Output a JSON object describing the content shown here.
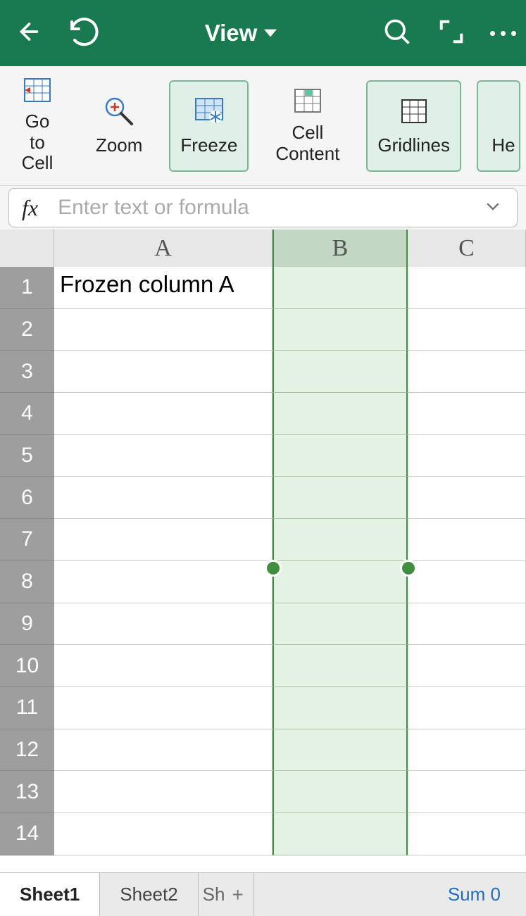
{
  "header": {
    "title": "View"
  },
  "ribbon": {
    "goToCell": "Go to\nCell",
    "zoom": "Zoom",
    "freeze": "Freeze",
    "cellContent": "Cell\nContent",
    "gridlines": "Gridlines",
    "headings": "He"
  },
  "formulaBar": {
    "fx": "fx",
    "placeholder": "Enter text or formula"
  },
  "columns": {
    "A": "A",
    "B": "B",
    "C": "C"
  },
  "rows": [
    1,
    2,
    3,
    4,
    5,
    6,
    7,
    8,
    9,
    10,
    11,
    12,
    13,
    14
  ],
  "cells": {
    "A1": "Frozen column A"
  },
  "tabs": {
    "sheet1": "Sheet1",
    "sheet2": "Sheet2",
    "sheet3": "Sh",
    "sum": "Sum 0"
  }
}
